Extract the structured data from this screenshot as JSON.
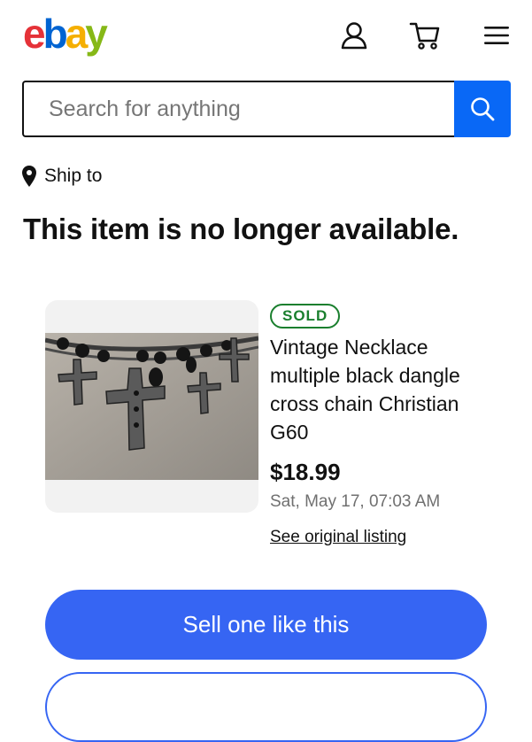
{
  "header": {
    "logo_letters": [
      {
        "char": "e",
        "color": "#e53238"
      },
      {
        "char": "b",
        "color": "#0064d2"
      },
      {
        "char": "a",
        "color": "#f5af02"
      },
      {
        "char": "y",
        "color": "#86b817"
      }
    ],
    "icons": [
      "user-icon",
      "cart-icon",
      "menu-icon"
    ]
  },
  "search": {
    "placeholder": "Search for anything",
    "button_icon": "search-icon"
  },
  "ship": {
    "icon": "location-pin-icon",
    "label": "Ship to"
  },
  "page": {
    "title": "This item is no longer available."
  },
  "item": {
    "badge": "SOLD",
    "title": "Vintage Necklace multiple black dangle cross chain Christian G60",
    "price": "$18.99",
    "date": "Sat, May 17, 07:03 AM",
    "link": "See original listing"
  },
  "actions": {
    "sell": "Sell one like this"
  },
  "colors": {
    "accent_blue": "#3665f3",
    "search_blue": "#0968f6",
    "sold_green": "#1a7f2e"
  }
}
